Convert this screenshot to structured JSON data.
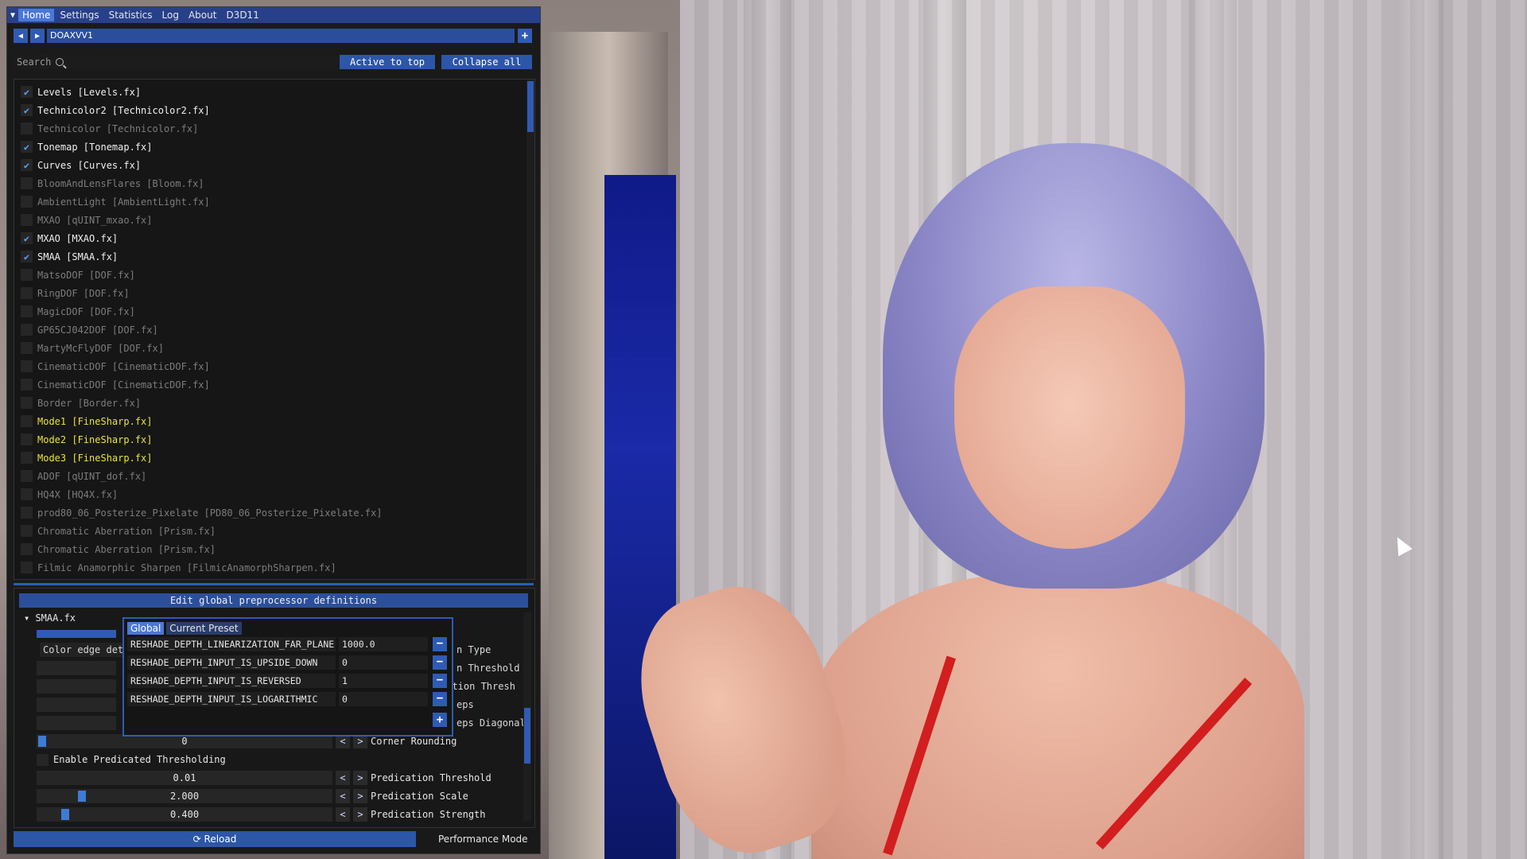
{
  "tabs": [
    "Home",
    "Settings",
    "Statistics",
    "Log",
    "About",
    "D3D11"
  ],
  "preset": {
    "name": "DOAXVV1"
  },
  "search": {
    "placeholder": "Search"
  },
  "buttons": {
    "active_to_top": "Active to top",
    "collapse_all": "Collapse all",
    "reload": "Reload"
  },
  "effects": [
    {
      "label": "Levels [Levels.fx]",
      "state": "on"
    },
    {
      "label": "Technicolor2 [Technicolor2.fx]",
      "state": "on"
    },
    {
      "label": "Technicolor [Technicolor.fx]",
      "state": "off"
    },
    {
      "label": "Tonemap [Tonemap.fx]",
      "state": "on"
    },
    {
      "label": "Curves [Curves.fx]",
      "state": "on"
    },
    {
      "label": "BloomAndLensFlares [Bloom.fx]",
      "state": "off"
    },
    {
      "label": "AmbientLight [AmbientLight.fx]",
      "state": "off"
    },
    {
      "label": "MXAO [qUINT_mxao.fx]",
      "state": "off"
    },
    {
      "label": "MXAO [MXAO.fx]",
      "state": "on"
    },
    {
      "label": "SMAA [SMAA.fx]",
      "state": "on"
    },
    {
      "label": "MatsoDOF [DOF.fx]",
      "state": "off"
    },
    {
      "label": "RingDOF [DOF.fx]",
      "state": "off"
    },
    {
      "label": "MagicDOF [DOF.fx]",
      "state": "off"
    },
    {
      "label": "GP65CJ042DOF [DOF.fx]",
      "state": "off"
    },
    {
      "label": "MartyMcFlyDOF [DOF.fx]",
      "state": "off"
    },
    {
      "label": "CinematicDOF [CinematicDOF.fx]",
      "state": "off"
    },
    {
      "label": "CinematicDOF [CinematicDOF.fx]",
      "state": "off"
    },
    {
      "label": "Border [Border.fx]",
      "state": "off"
    },
    {
      "label": "Mode1 [FineSharp.fx]",
      "state": "warn"
    },
    {
      "label": "Mode2 [FineSharp.fx]",
      "state": "warn"
    },
    {
      "label": "Mode3 [FineSharp.fx]",
      "state": "warn"
    },
    {
      "label": "ADOF [qUINT_dof.fx]",
      "state": "off"
    },
    {
      "label": "HQ4X [HQ4X.fx]",
      "state": "off"
    },
    {
      "label": "prod80_06_Posterize_Pixelate [PD80_06_Posterize_Pixelate.fx]",
      "state": "off"
    },
    {
      "label": "Chromatic Aberration [Prism.fx]",
      "state": "off"
    },
    {
      "label": "Chromatic Aberration [Prism.fx]",
      "state": "off"
    },
    {
      "label": "Filmic Anamorphic Sharpen [FilmicAnamorphSharpen.fx]",
      "state": "off"
    }
  ],
  "lower": {
    "section_header": "Edit global preprocessor definitions",
    "effect_title": "SMAA.fx",
    "color_edge_label": "Color edge det",
    "partial_labels": [
      "n Type",
      "n Threshold",
      "ection Thresh",
      "eps",
      "eps Diagonal"
    ],
    "corner_rounding": {
      "value": "0",
      "label": "Corner Rounding",
      "fraction": 0.0
    },
    "enable_predicated": "Enable Predicated Thresholding",
    "predication_threshold": {
      "value": "0.01",
      "label": "Predication Threshold",
      "fraction": 0.0
    },
    "predication_scale": {
      "value": "2.000",
      "label": "Predication Scale",
      "fraction": 0.14
    },
    "predication_strength": {
      "value": "0.400",
      "label": "Predication Strength",
      "fraction": 0.08
    }
  },
  "popup": {
    "tabs": [
      "Global",
      "Current Preset"
    ],
    "definitions": [
      {
        "name": "RESHADE_DEPTH_LINEARIZATION_FAR_PLANE",
        "value": "1000.0"
      },
      {
        "name": "RESHADE_DEPTH_INPUT_IS_UPSIDE_DOWN",
        "value": "0"
      },
      {
        "name": "RESHADE_DEPTH_INPUT_IS_REVERSED",
        "value": "1"
      },
      {
        "name": "RESHADE_DEPTH_INPUT_IS_LOGARITHMIC",
        "value": "0"
      }
    ]
  },
  "footer": {
    "perf_mode": "Performance Mode"
  },
  "colors": {
    "accent": "#2f5bb4",
    "tab_active": "#4a78d8",
    "warn": "#e8e23a"
  }
}
